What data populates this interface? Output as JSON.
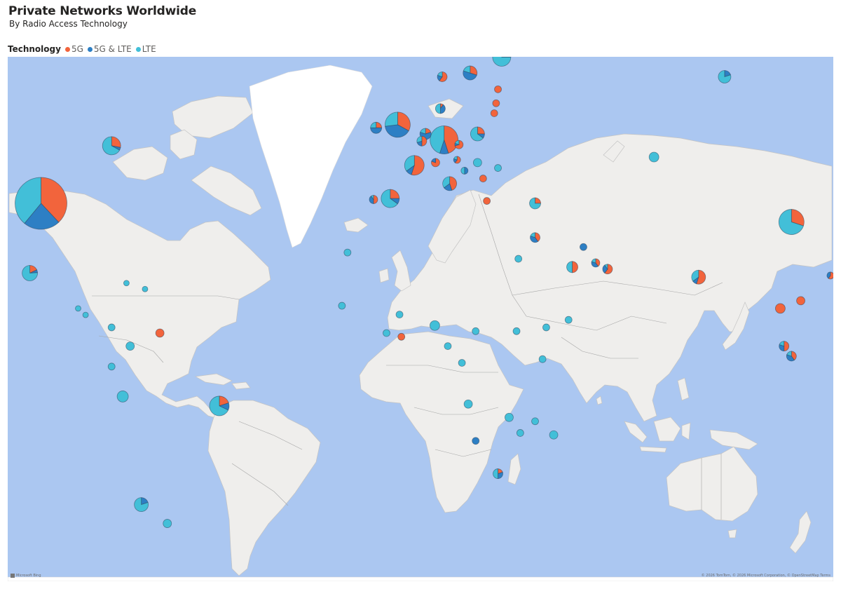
{
  "header": {
    "title": "Private Networks Worldwide",
    "subtitle": "By Radio Access Technology"
  },
  "legend": {
    "title": "Technology",
    "items": [
      {
        "label": "5G",
        "color": "#f2643c"
      },
      {
        "label": "5G & LTE",
        "color": "#2d7fc4"
      },
      {
        "label": "LTE",
        "color": "#42bfd8"
      }
    ]
  },
  "map": {
    "brand": "Microsoft Bing",
    "attribution": "© 2026 TomTom, © 2026 Microsoft Corporation, © OpenStreetMap  Terms",
    "water_color": "#abc7f1",
    "land_color": "#efeeec",
    "markers": [
      {
        "lon": -98,
        "lat": 39,
        "r": 37,
        "v": [
          38,
          23,
          39
        ]
      },
      {
        "lon": -79,
        "lat": 50,
        "r": 13,
        "v": [
          28,
          5,
          67
        ]
      },
      {
        "lon": -101,
        "lat": 23,
        "r": 11,
        "v": [
          18,
          6,
          76
        ]
      },
      {
        "lon": -75,
        "lat": 20.5,
        "r": 4,
        "v": [
          0,
          0,
          100
        ]
      },
      {
        "lon": -70,
        "lat": 19,
        "r": 4,
        "v": [
          0,
          0,
          100
        ]
      },
      {
        "lon": -88,
        "lat": 14,
        "r": 4,
        "v": [
          0,
          0,
          100
        ]
      },
      {
        "lon": -86,
        "lat": 12.3,
        "r": 4,
        "v": [
          0,
          0,
          100
        ]
      },
      {
        "lon": -79,
        "lat": 9,
        "r": 5,
        "v": [
          0,
          0,
          100
        ]
      },
      {
        "lon": -74,
        "lat": 4,
        "r": 6,
        "v": [
          0,
          0,
          100
        ]
      },
      {
        "lon": -66,
        "lat": 7.5,
        "r": 6,
        "v": [
          100,
          0,
          0
        ]
      },
      {
        "lon": -79,
        "lat": -1.5,
        "r": 5,
        "v": [
          0,
          0,
          100
        ]
      },
      {
        "lon": -76,
        "lat": -9.5,
        "r": 8,
        "v": [
          0,
          0,
          100
        ]
      },
      {
        "lon": -50,
        "lat": -12,
        "r": 14,
        "v": [
          20,
          12,
          68
        ]
      },
      {
        "lon": -71,
        "lat": -36,
        "r": 10,
        "v": [
          0,
          20,
          80
        ]
      },
      {
        "lon": -64,
        "lat": -40,
        "r": 6,
        "v": [
          0,
          0,
          100
        ]
      },
      {
        "lon": -2,
        "lat": 53.5,
        "r": 18,
        "v": [
          33,
          40,
          27
        ]
      },
      {
        "lon": -7.8,
        "lat": 53,
        "r": 8,
        "v": [
          25,
          50,
          25
        ]
      },
      {
        "lon": 2.5,
        "lat": 46.5,
        "r": 14,
        "v": [
          55,
          10,
          35
        ]
      },
      {
        "lon": 10.5,
        "lat": 51,
        "r": 20,
        "v": [
          45,
          10,
          45
        ]
      },
      {
        "lon": 5.5,
        "lat": 52,
        "r": 8,
        "v": [
          20,
          60,
          20
        ]
      },
      {
        "lon": 4.5,
        "lat": 50.8,
        "r": 7,
        "v": [
          50,
          20,
          30
        ]
      },
      {
        "lon": 14.5,
        "lat": 50.2,
        "r": 6,
        "v": [
          70,
          10,
          20
        ]
      },
      {
        "lon": 8.2,
        "lat": 47,
        "r": 6,
        "v": [
          80,
          20,
          0
        ]
      },
      {
        "lon": 14,
        "lat": 47.5,
        "r": 5,
        "v": [
          60,
          20,
          20
        ]
      },
      {
        "lon": 19.5,
        "lat": 52,
        "r": 10,
        "v": [
          25,
          10,
          65
        ]
      },
      {
        "lon": 9.5,
        "lat": 56,
        "r": 7,
        "v": [
          10,
          40,
          50
        ]
      },
      {
        "lon": 12,
        "lat": 43,
        "r": 10,
        "v": [
          45,
          20,
          35
        ]
      },
      {
        "lon": -4,
        "lat": 40,
        "r": 13,
        "v": [
          25,
          10,
          65
        ]
      },
      {
        "lon": -8.5,
        "lat": 39.8,
        "r": 6,
        "v": [
          50,
          40,
          10
        ]
      },
      {
        "lon": 17.5,
        "lat": 61,
        "r": 10,
        "v": [
          30,
          50,
          20
        ]
      },
      {
        "lon": 10,
        "lat": 60.5,
        "r": 7,
        "v": [
          60,
          20,
          20
        ]
      },
      {
        "lon": 26,
        "lat": 63,
        "r": 13,
        "v": [
          10,
          15,
          75
        ]
      },
      {
        "lon": 25,
        "lat": 58.8,
        "r": 5,
        "v": [
          100,
          0,
          0
        ]
      },
      {
        "lon": 24.5,
        "lat": 56.8,
        "r": 5,
        "v": [
          100,
          0,
          0
        ]
      },
      {
        "lon": 24,
        "lat": 55.3,
        "r": 5,
        "v": [
          100,
          0,
          0
        ]
      },
      {
        "lon": 19.5,
        "lat": 47,
        "r": 6,
        "v": [
          0,
          0,
          100
        ]
      },
      {
        "lon": 25,
        "lat": 46,
        "r": 5,
        "v": [
          0,
          0,
          100
        ]
      },
      {
        "lon": 21,
        "lat": 44,
        "r": 5,
        "v": [
          100,
          0,
          0
        ]
      },
      {
        "lon": 16,
        "lat": 45.5,
        "r": 5,
        "v": [
          0,
          50,
          50
        ]
      },
      {
        "lon": 22,
        "lat": 39.5,
        "r": 5,
        "v": [
          100,
          0,
          0
        ]
      },
      {
        "lon": 35,
        "lat": 39,
        "r": 8,
        "v": [
          25,
          0,
          75
        ]
      },
      {
        "lon": 67,
        "lat": 48,
        "r": 7,
        "v": [
          0,
          0,
          100
        ]
      },
      {
        "lon": 86,
        "lat": 60.5,
        "r": 9,
        "v": [
          0,
          20,
          80
        ]
      },
      {
        "lon": 35,
        "lat": 31.5,
        "r": 7,
        "v": [
          40,
          40,
          20
        ]
      },
      {
        "lon": 30.5,
        "lat": 26.5,
        "r": 5,
        "v": [
          0,
          0,
          100
        ]
      },
      {
        "lon": 45,
        "lat": 24.5,
        "r": 8,
        "v": [
          50,
          0,
          50
        ]
      },
      {
        "lon": 48,
        "lat": 29.3,
        "r": 5,
        "v": [
          0,
          100,
          0
        ]
      },
      {
        "lon": 51.3,
        "lat": 25.5,
        "r": 6,
        "v": [
          40,
          40,
          20
        ]
      },
      {
        "lon": 54.5,
        "lat": 24,
        "r": 7,
        "v": [
          60,
          30,
          10
        ]
      },
      {
        "lon": 79,
        "lat": 22,
        "r": 10,
        "v": [
          55,
          10,
          35
        ]
      },
      {
        "lon": 104,
        "lat": 35,
        "r": 18,
        "v": [
          30,
          0,
          70
        ]
      },
      {
        "lon": 127.5,
        "lat": 36.5,
        "r": 14,
        "v": [
          55,
          35,
          10
        ]
      },
      {
        "lon": 138,
        "lat": 37.5,
        "r": 16,
        "v": [
          40,
          45,
          15
        ]
      },
      {
        "lon": 121,
        "lat": 23.7,
        "r": 9,
        "v": [
          50,
          30,
          20
        ]
      },
      {
        "lon": 114.5,
        "lat": 22.4,
        "r": 5,
        "v": [
          60,
          40,
          0
        ]
      },
      {
        "lon": 121,
        "lat": 14.6,
        "r": 5,
        "v": [
          0,
          0,
          100
        ]
      },
      {
        "lon": 106.5,
        "lat": 16,
        "r": 6,
        "v": [
          100,
          0,
          0
        ]
      },
      {
        "lon": 101,
        "lat": 14,
        "r": 7,
        "v": [
          100,
          0,
          0
        ]
      },
      {
        "lon": 102,
        "lat": 4,
        "r": 7,
        "v": [
          50,
          30,
          20
        ]
      },
      {
        "lon": 104,
        "lat": 1.3,
        "r": 7,
        "v": [
          40,
          40,
          20
        ]
      },
      {
        "lon": 120,
        "lat": -2,
        "r": 7,
        "v": [
          0,
          40,
          60
        ]
      },
      {
        "lon": 145,
        "lat": -6,
        "r": 6,
        "v": [
          100,
          0,
          0
        ]
      },
      {
        "lon": 134,
        "lat": -25,
        "r": 15,
        "v": [
          15,
          15,
          70
        ]
      },
      {
        "lon": 172.5,
        "lat": -41.5,
        "r": 7,
        "v": [
          50,
          10,
          40
        ]
      },
      {
        "lon": 166,
        "lat": -21.5,
        "r": 5,
        "v": [
          0,
          0,
          100
        ]
      },
      {
        "lon": -17,
        "lat": 14.7,
        "r": 5,
        "v": [
          0,
          0,
          100
        ]
      },
      {
        "lon": -15.5,
        "lat": 28,
        "r": 5,
        "v": [
          0,
          0,
          100
        ]
      },
      {
        "lon": -1.5,
        "lat": 12.4,
        "r": 5,
        "v": [
          0,
          0,
          100
        ]
      },
      {
        "lon": -5,
        "lat": 7.5,
        "r": 5,
        "v": [
          0,
          0,
          100
        ]
      },
      {
        "lon": -1,
        "lat": 6.5,
        "r": 5,
        "v": [
          100,
          0,
          0
        ]
      },
      {
        "lon": 8,
        "lat": 9.5,
        "r": 7,
        "v": [
          0,
          0,
          100
        ]
      },
      {
        "lon": 11.5,
        "lat": 4,
        "r": 5,
        "v": [
          0,
          0,
          100
        ]
      },
      {
        "lon": 19,
        "lat": 8,
        "r": 5,
        "v": [
          0,
          0,
          100
        ]
      },
      {
        "lon": 30,
        "lat": 8,
        "r": 5,
        "v": [
          0,
          0,
          100
        ]
      },
      {
        "lon": 38,
        "lat": 9,
        "r": 5,
        "v": [
          0,
          0,
          100
        ]
      },
      {
        "lon": 44,
        "lat": 11,
        "r": 5,
        "v": [
          0,
          0,
          100
        ]
      },
      {
        "lon": 37,
        "lat": 0.5,
        "r": 5,
        "v": [
          0,
          0,
          100
        ]
      },
      {
        "lon": 15.3,
        "lat": -0.5,
        "r": 5,
        "v": [
          0,
          0,
          100
        ]
      },
      {
        "lon": 17,
        "lat": -11.5,
        "r": 6,
        "v": [
          0,
          0,
          100
        ]
      },
      {
        "lon": 28,
        "lat": -15,
        "r": 6,
        "v": [
          0,
          0,
          100
        ]
      },
      {
        "lon": 35,
        "lat": -16,
        "r": 5,
        "v": [
          0,
          0,
          100
        ]
      },
      {
        "lon": 40,
        "lat": -19.5,
        "r": 6,
        "v": [
          0,
          0,
          100
        ]
      },
      {
        "lon": 31,
        "lat": -19,
        "r": 5,
        "v": [
          0,
          0,
          100
        ]
      },
      {
        "lon": 19,
        "lat": -21,
        "r": 5,
        "v": [
          0,
          100,
          0
        ]
      },
      {
        "lon": 25,
        "lat": -29,
        "r": 7,
        "v": [
          20,
          30,
          50
        ]
      }
    ]
  }
}
